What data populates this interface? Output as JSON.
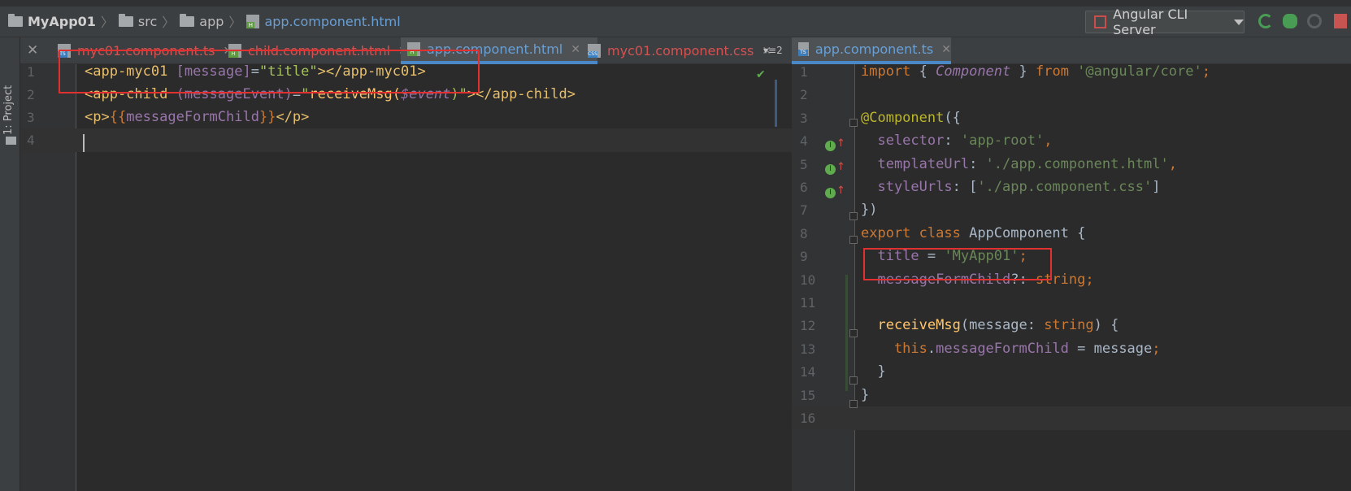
{
  "navbar": {
    "crumbs": [
      "MyApp01",
      "src",
      "app",
      "app.component.html"
    ],
    "run_config": "Angular CLI Server"
  },
  "sidebar": {
    "project_label": "1: Project"
  },
  "left_tabs": [
    {
      "label": "myc01.component.ts",
      "type": "TS",
      "state": "error"
    },
    {
      "label": "child.component.html",
      "type": "H",
      "state": "error"
    },
    {
      "label": "app.component.html",
      "type": "H",
      "state": "selected"
    },
    {
      "label": "myc01.component.css",
      "type": "CSS",
      "state": "error"
    }
  ],
  "tab_overflow": "2",
  "right_tabs": [
    {
      "label": "app.component.ts",
      "type": "TS",
      "state": "selected"
    }
  ],
  "left_editor": {
    "line_numbers": [
      "1",
      "2",
      "3",
      "4"
    ],
    "lines": [
      [
        [
          "<app-myc01 ",
          "tag"
        ],
        [
          "[message]",
          "attr"
        ],
        [
          "=",
          "plain"
        ],
        [
          "\"title\"",
          "qstr"
        ],
        [
          "></app-myc01>",
          "tag"
        ]
      ],
      [
        [
          "<app-child ",
          "tag"
        ],
        [
          "(messageEvent)",
          "attr"
        ],
        [
          "=",
          "plain"
        ],
        [
          "\"",
          "qstr"
        ],
        [
          "receiveMsg(",
          "fn"
        ],
        [
          "$event",
          "ital"
        ],
        [
          ")\"",
          "qstr"
        ],
        [
          "></app-child>",
          "tag"
        ]
      ],
      [
        [
          "<p>",
          "tag"
        ],
        [
          "{{",
          "kw"
        ],
        [
          "messageFormChild",
          "prop"
        ],
        [
          "}}",
          "kw"
        ],
        [
          "</p>",
          "tag"
        ]
      ],
      []
    ]
  },
  "right_editor": {
    "line_numbers": [
      "1",
      "2",
      "3",
      "4",
      "5",
      "6",
      "7",
      "8",
      "9",
      "10",
      "11",
      "12",
      "13",
      "14",
      "15",
      "16"
    ],
    "lines": [
      [
        [
          "import ",
          "kw"
        ],
        [
          "{ ",
          "plain"
        ],
        [
          "Component",
          "ital"
        ],
        [
          " } ",
          "plain"
        ],
        [
          "from ",
          "kw"
        ],
        [
          "'@angular/core'",
          "str"
        ],
        [
          ";",
          "kw"
        ]
      ],
      [],
      [
        [
          "@Component",
          "ann"
        ],
        [
          "({",
          "plain"
        ]
      ],
      [
        [
          "  selector",
          "prop"
        ],
        [
          ": ",
          "plain"
        ],
        [
          "'app-root'",
          "str"
        ],
        [
          ",",
          "kw"
        ]
      ],
      [
        [
          "  templateUrl",
          "prop"
        ],
        [
          ": ",
          "plain"
        ],
        [
          "'./app.component.html'",
          "str"
        ],
        [
          ",",
          "kw"
        ]
      ],
      [
        [
          "  styleUrls",
          "prop"
        ],
        [
          ": [",
          "plain"
        ],
        [
          "'./app.component.css'",
          "str"
        ],
        [
          "]",
          "plain"
        ]
      ],
      [
        [
          "})",
          "plain"
        ]
      ],
      [
        [
          "export ",
          "kw"
        ],
        [
          "class ",
          "kw"
        ],
        [
          "AppComponent ",
          "class"
        ],
        [
          "{",
          "plain"
        ]
      ],
      [
        [
          "  title",
          "prop"
        ],
        [
          " = ",
          "plain"
        ],
        [
          "'MyApp01'",
          "str"
        ],
        [
          ";",
          "kw"
        ]
      ],
      [
        [
          "  messageFormChild",
          "prop"
        ],
        [
          "?: ",
          "plain"
        ],
        [
          "string",
          "kw"
        ],
        [
          ";",
          "kw"
        ]
      ],
      [],
      [
        [
          "  receiveMsg",
          "fn"
        ],
        [
          "(message: ",
          "plain"
        ],
        [
          "string",
          "kw"
        ],
        [
          ") {",
          "plain"
        ]
      ],
      [
        [
          "    this",
          "kw"
        ],
        [
          ".",
          "plain"
        ],
        [
          "messageFormChild",
          "prop"
        ],
        [
          " = message",
          "plain"
        ],
        [
          ";",
          "kw"
        ]
      ],
      [
        [
          "  }",
          "plain"
        ]
      ],
      [
        [
          "}",
          "plain"
        ]
      ],
      []
    ]
  }
}
